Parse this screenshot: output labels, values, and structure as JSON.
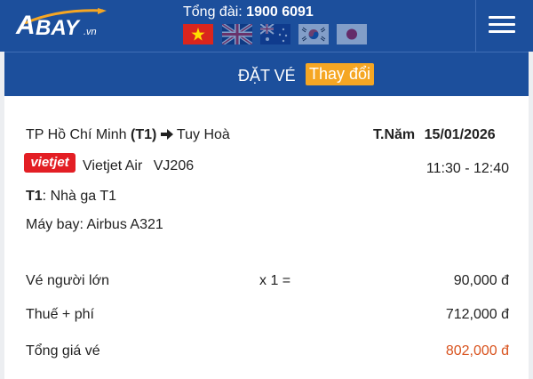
{
  "header": {
    "logo": {
      "a": "A",
      "bay": "BAY",
      "vn": ".vn"
    },
    "hotline_label": "Tổng đài:",
    "hotline_number": "1900 6091",
    "flags": [
      {
        "name": "vietnam-flag",
        "active": true
      },
      {
        "name": "uk-flag",
        "active": false
      },
      {
        "name": "australia-flag",
        "active": false
      },
      {
        "name": "korea-flag",
        "active": false
      },
      {
        "name": "japan-flag",
        "active": false
      }
    ],
    "menu_icon": "hamburger-icon"
  },
  "booking_bar": {
    "title": "ĐẶT VÉ",
    "change_label": "Thay đổi"
  },
  "flight": {
    "origin": "TP Hồ Chí Minh",
    "origin_code": "(T1)",
    "destination": "Tuy Hoà",
    "date_day": "T.Năm",
    "date": "15/01/2026",
    "airline_logo_text": "vietjet",
    "airline": "Vietjet Air",
    "flight_no": "VJ206",
    "time": "11:30 - 12:40",
    "terminal_code": "T1",
    "terminal_text": ": Nhà ga T1",
    "aircraft": "Máy bay: Airbus A321"
  },
  "pricing": {
    "adult_label": "Vé người lớn",
    "adult_qty": "x 1 =",
    "adult_price": "90,000 đ",
    "tax_label": "Thuế + phí",
    "tax_price": "712,000 đ",
    "total_label": "Tổng giá vé",
    "total_price": "802,000 đ"
  },
  "colors": {
    "header_bg": "#1c4f9c",
    "accent": "#f5a623",
    "total_price": "#d9531e",
    "airline_red": "#e31e24"
  }
}
